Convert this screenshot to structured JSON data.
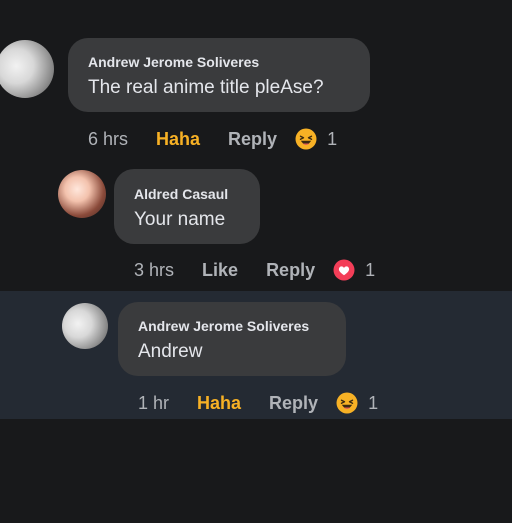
{
  "comments": [
    {
      "author": "Andrew Jerome Soliveres",
      "text": "The real anime title pleAse?",
      "time": "6 hrs",
      "reaction_action": "Haha",
      "reply": "Reply",
      "reaction_icon": "haha-emoji-icon",
      "reaction_count": "1"
    },
    {
      "author": "Aldred Casaul",
      "text": "Your name",
      "time": "3 hrs",
      "reaction_action": "Like",
      "reply": "Reply",
      "reaction_icon": "love-reaction-icon",
      "reaction_count": "1"
    },
    {
      "author": "Andrew Jerome Soliveres",
      "text": "Andrew",
      "time": "1 hr",
      "reaction_action": "Haha",
      "reply": "Reply",
      "reaction_icon": "haha-emoji-icon",
      "reaction_count": "1"
    }
  ],
  "colors": {
    "background": "#18191b",
    "highlight": "#242a33",
    "bubble": "#3a3b3d",
    "text": "#e4e6eb",
    "muted": "#b0b3b8",
    "haha": "#f7b125",
    "love": "#f33e58"
  }
}
